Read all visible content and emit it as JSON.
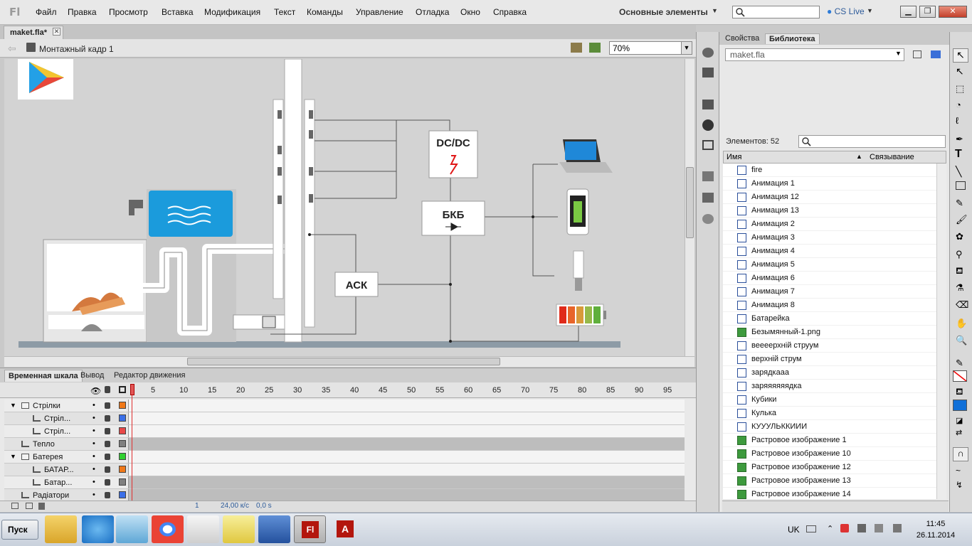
{
  "app": {
    "logo": "Fl"
  },
  "menu": [
    "Файл",
    "Правка",
    "Просмотр",
    "Вставка",
    "Модификация",
    "Текст",
    "Команды",
    "Управление",
    "Отладка",
    "Окно",
    "Справка"
  ],
  "workspace": "Основные элементы",
  "cslive": "CS Live",
  "document_tab": "maket.fla*",
  "scene": "Монтажный кадр 1",
  "zoom": "70%",
  "stage": {
    "dcdc": "DC/DC",
    "bkb": "БКБ",
    "ack": "АСК"
  },
  "timeline": {
    "tabs": [
      "Временная шкала",
      "Вывод",
      "Редактор движения"
    ],
    "ruler": [
      "1",
      "5",
      "10",
      "15",
      "20",
      "25",
      "30",
      "35",
      "40",
      "45",
      "50",
      "55",
      "60",
      "65",
      "70",
      "75",
      "80",
      "85",
      "90",
      "95"
    ],
    "layers": [
      {
        "name": "Стрілки",
        "type": "folder",
        "color": "#f07818"
      },
      {
        "name": "Стріл...",
        "type": "layer",
        "color": "#3a6fe8"
      },
      {
        "name": "Стріл...",
        "type": "layer",
        "color": "#e84848"
      },
      {
        "name": "Тепло",
        "type": "layer",
        "color": "#808080"
      },
      {
        "name": "Батерея",
        "type": "folder",
        "color": "#30d030"
      },
      {
        "name": "БАТАР...",
        "type": "layer",
        "color": "#f07818"
      },
      {
        "name": "Батар...",
        "type": "layer",
        "color": "#808080"
      },
      {
        "name": "Радіатори",
        "type": "layer",
        "color": "#3a6fe8"
      }
    ],
    "current_frame": "1",
    "fps": "24,00 к/с",
    "time": "0,0 s"
  },
  "panel": {
    "tabs": [
      "Свойства",
      "Библиотека"
    ],
    "library_file": "maket.fla",
    "count_label": "Элементов: 52",
    "col_name": "Имя",
    "col_link": "Связывание",
    "items": [
      {
        "name": "fire",
        "kind": "symbol"
      },
      {
        "name": "Анимация 1",
        "kind": "symbol"
      },
      {
        "name": "Анимация 12",
        "kind": "symbol"
      },
      {
        "name": "Анимация 13",
        "kind": "symbol"
      },
      {
        "name": "Анимация 2",
        "kind": "symbol"
      },
      {
        "name": "Анимация 3",
        "kind": "symbol"
      },
      {
        "name": "Анимация 4",
        "kind": "symbol"
      },
      {
        "name": "Анимация 5",
        "kind": "symbol"
      },
      {
        "name": "Анимация 6",
        "kind": "symbol"
      },
      {
        "name": "Анимация 7",
        "kind": "symbol"
      },
      {
        "name": "Анимация 8",
        "kind": "symbol"
      },
      {
        "name": "Батарейка",
        "kind": "symbol"
      },
      {
        "name": "Безымянный-1.png",
        "kind": "bitmap"
      },
      {
        "name": "веееерхній струум",
        "kind": "symbol"
      },
      {
        "name": "верхній струм",
        "kind": "symbol"
      },
      {
        "name": "зарядкааа",
        "kind": "symbol"
      },
      {
        "name": "заряяяяяядка",
        "kind": "symbol"
      },
      {
        "name": "Кубики",
        "kind": "symbol"
      },
      {
        "name": "Кулька",
        "kind": "symbol"
      },
      {
        "name": "КУУУЛЬККИИИ",
        "kind": "symbol"
      },
      {
        "name": "Растровое изображение 1",
        "kind": "bitmap"
      },
      {
        "name": "Растровое изображение 10",
        "kind": "bitmap"
      },
      {
        "name": "Растровое изображение 12",
        "kind": "bitmap"
      },
      {
        "name": "Растровое изображение 13",
        "kind": "bitmap"
      },
      {
        "name": "Растровое изображение 14",
        "kind": "bitmap"
      }
    ]
  },
  "taskbar": {
    "start": "Пуск",
    "lang": "UK",
    "time": "11:45",
    "date": "26.11.2014"
  }
}
